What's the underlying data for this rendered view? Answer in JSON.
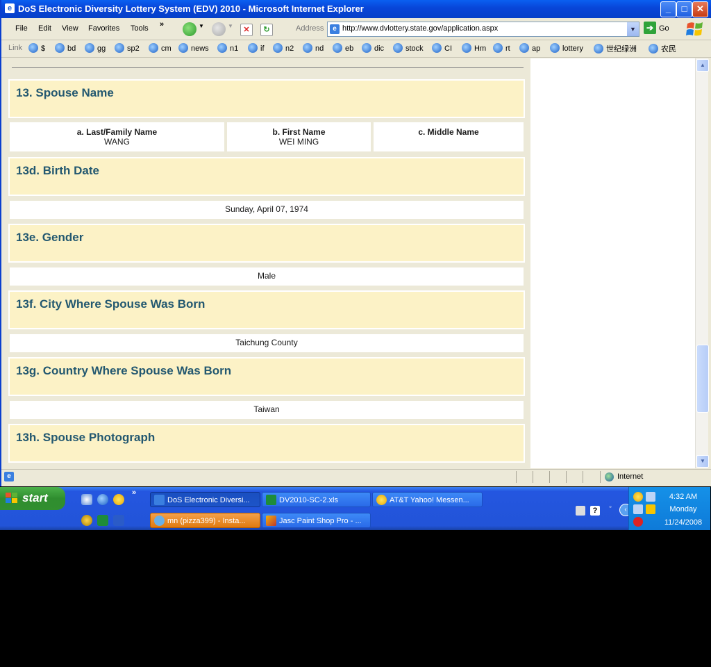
{
  "window": {
    "title": "DoS Electronic Diversity Lottery System (EDV) 2010 - Microsoft Internet Explorer",
    "minimize": "_",
    "maximize": "□",
    "close": "✕"
  },
  "menubar": {
    "items": [
      "File",
      "Edit",
      "View",
      "Favorites",
      "Tools"
    ],
    "more": "»"
  },
  "address": {
    "label": "Address",
    "url": "http://www.dvlottery.state.gov/application.aspx",
    "go_label": "Go"
  },
  "links": {
    "title": "Link",
    "items": [
      "$",
      "bd",
      "gg",
      "sp2",
      "cm",
      "news",
      "n1",
      "if",
      "n2",
      "nd",
      "eb",
      "dic",
      "stock",
      "CI",
      "Hm",
      "rt",
      "ap",
      "lottery",
      "世纪绿洲",
      "农民"
    ]
  },
  "form": {
    "spouse_name_header": "13. Spouse Name",
    "last_name_label": "a. Last/Family Name",
    "last_name_value": "WANG",
    "first_name_label": "b. First Name",
    "first_name_value": "WEI MING",
    "middle_name_label": "c. Middle Name",
    "middle_name_value": "",
    "birth_date_header": "13d. Birth Date",
    "birth_date_value": "Sunday, April 07, 1974",
    "gender_header": "13e. Gender",
    "gender_value": "Male",
    "city_header": "13f. City Where Spouse Was Born",
    "city_value": "Taichung County",
    "country_header": "13g. Country Where Spouse Was Born",
    "country_value": "Taiwan",
    "photo_header": "13h. Spouse Photograph"
  },
  "statusbar": {
    "zone": "Internet"
  },
  "taskbar": {
    "start_label": "start",
    "tasks": [
      "DoS Electronic Diversi...",
      "DV2010-SC-2.xls",
      "AT&T Yahoo! Messen...",
      "mn (pizza399) - Insta...",
      "Jasc Paint Shop Pro - ..."
    ],
    "clock_time": "4:32 AM",
    "clock_day": "Monday",
    "clock_date": "11/24/2008"
  },
  "colors": {
    "header_bg": "#FCF2C6",
    "header_text": "#235870",
    "titlebar": "#0845D8",
    "start_green": "#318F2F"
  }
}
